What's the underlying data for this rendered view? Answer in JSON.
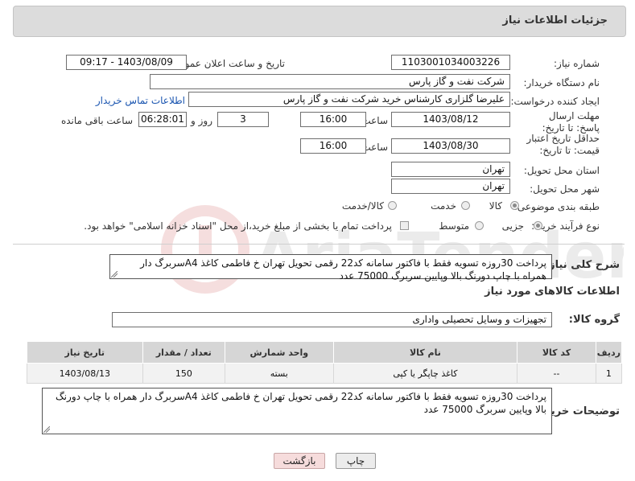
{
  "header": {
    "title": "جزئیات اطلاعات نیاز"
  },
  "fields": {
    "need_number_label": "شماره نیاز:",
    "need_number": "1103001034003226",
    "announce_label": "تاریخ و ساعت اعلان عمومی:",
    "announce_value": "1403/08/09 - 09:17",
    "buyer_org_label": "نام دستگاه خریدار:",
    "buyer_org": "شرکت نفت و گاز پارس",
    "creator_label": "ایجاد کننده درخواست:",
    "creator": "علیرضا  گلزاری کارشناس خرید  شرکت نفت و گاز پارس",
    "contact_link": "اطلاعات تماس خریدار",
    "deadline_label": "مهلت ارسال پاسخ: تا تاریخ:",
    "deadline_date": "1403/08/12",
    "time_label": "ساعت",
    "deadline_time": "16:00",
    "days": "3",
    "days_label": "روز و",
    "remaining_time": "06:28:01",
    "remaining_label": "ساعت باقی مانده",
    "validity_label": "حداقل تاریخ اعتبار قیمت: تا تاریخ:",
    "validity_date": "1403/08/30",
    "validity_time": "16:00",
    "province_label": "استان محل تحویل:",
    "province": "تهران",
    "city_label": "شهر محل تحویل:",
    "city": "تهران",
    "category_label": "طبقه بندی موضوعی:",
    "category_options": [
      "کالا",
      "خدمت",
      "کالا/خدمت"
    ],
    "category_selected": "کالا",
    "process_label": "نوع فرآیند خرید :",
    "process_options": [
      "جزیی",
      "متوسط"
    ],
    "process_selected": "جزیی",
    "treasury_note": "پرداخت تمام یا بخشی از مبلغ خرید،از محل \"اسناد خزانه اسلامی\" خواهد بود."
  },
  "description": {
    "label": "شرح کلی نیاز:",
    "text": "پرداخت 30روزه تسویه فقط با فاکتور سامانه کد22 رقمی تحویل تهران خ فاطمی کاغذ A4سربرگ دار همراه با چاپ دورنگ بالا وپایین سربرگ 75000 عدد"
  },
  "goods": {
    "section_title": "اطلاعات کالاهای مورد نیاز",
    "group_label": "گروه کالا:",
    "group_value": "تجهیزات و وسایل تحصیلی واداری",
    "columns": [
      "ردیف",
      "کد کالا",
      "نام کالا",
      "واحد شمارش",
      "تعداد / مقدار",
      "تاریخ نیاز"
    ],
    "rows": [
      [
        "1",
        "--",
        "کاغذ چاپگر یا کپی",
        "بسته",
        "150",
        "1403/08/13"
      ]
    ]
  },
  "buyer_notes": {
    "label": "توضیحات خریدار:",
    "text": "پرداخت 30روزه تسویه فقط با فاکتور سامانه کد22 رقمی تحویل تهران خ فاطمی کاغذ A4سربرگ دار همراه با چاپ دورنگ بالا وپایین سربرگ 75000 عدد"
  },
  "buttons": {
    "print": "چاپ",
    "back": "بازگشت"
  },
  "colors": {
    "panel": "#dcdcdc",
    "back_button": "#f6dcdc",
    "link": "#1a55b0"
  }
}
